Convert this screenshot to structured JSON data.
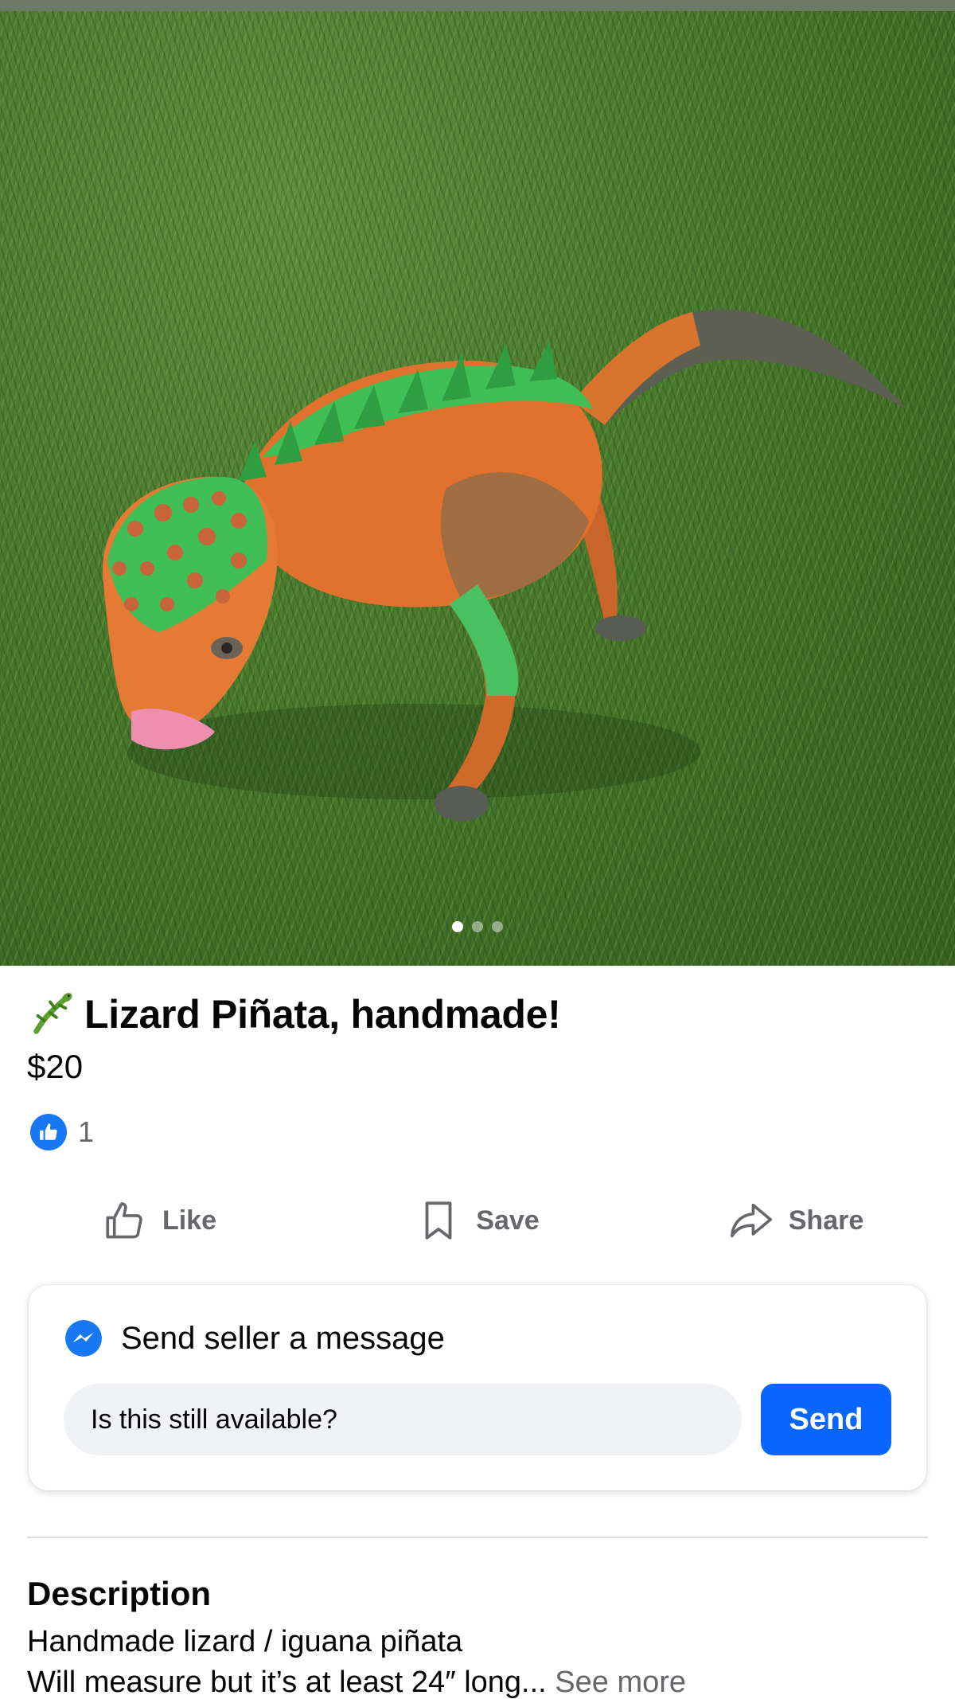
{
  "listing": {
    "photo_count": 3,
    "active_photo": 1,
    "title": "Lizard Piñata, handmade!",
    "price": "$20",
    "reaction_count": "1"
  },
  "actions": {
    "like": "Like",
    "save": "Save",
    "share": "Share"
  },
  "message": {
    "heading": "Send seller a message",
    "input_value": "Is this still available?",
    "send_label": "Send"
  },
  "description": {
    "heading": "Description",
    "line1": "Handmade lizard / iguana piñata",
    "line2": "Will measure but it’s at least 24″ long...",
    "see_more": "See more"
  },
  "colors": {
    "brand_blue": "#1877f2",
    "send_blue": "#0866ff",
    "muted_text": "#65676b"
  }
}
